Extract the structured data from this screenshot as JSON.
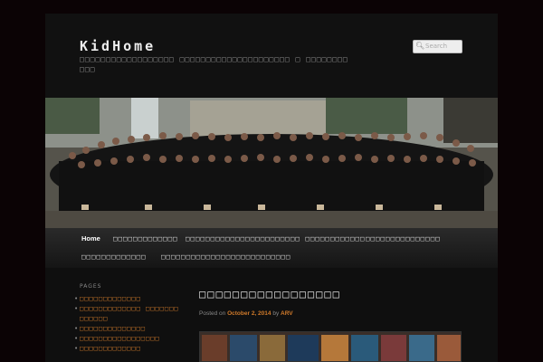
{
  "site": {
    "title": "KidHome",
    "description": "□□□□□□□□□□□□□□□□□□ □□□□□□□□□□□□□□□□□□□□□ □ □□□□□□□□□□□"
  },
  "search": {
    "placeholder": "Search"
  },
  "nav": {
    "items": [
      "Home",
      "□□□□□□□□□□□□□",
      "□□□□□□□□□□□□□□□□□□□□□□□ □□□□□□□□□□□□",
      "□□□□□□□□□□□□□□□",
      "□□□□□□□□□□□□□",
      "□□□□□□□□□□□□□□□□□□□□□□□□□□"
    ]
  },
  "sidebar": {
    "title": "PAGES",
    "items": [
      "□□□□□□□□□□□□□",
      "□□□□□□□□□□□□□ □□□□□□□□□□□□□",
      "□□□□□□□□□□□□□□",
      "□□□□□□□□□□□□□□□□□",
      "□□□□□□□□□□□□□"
    ]
  },
  "post": {
    "title": "□□□□□□□□□□□□□□□□□",
    "meta": {
      "posted_on": "Posted on",
      "date": "October 2, 2014",
      "by": "by",
      "author": "ARV"
    }
  },
  "colors": {
    "link": "#d07a2a",
    "page": "#0f0f0f",
    "background": "#0b0305"
  },
  "icons": {
    "search": "search-icon"
  }
}
